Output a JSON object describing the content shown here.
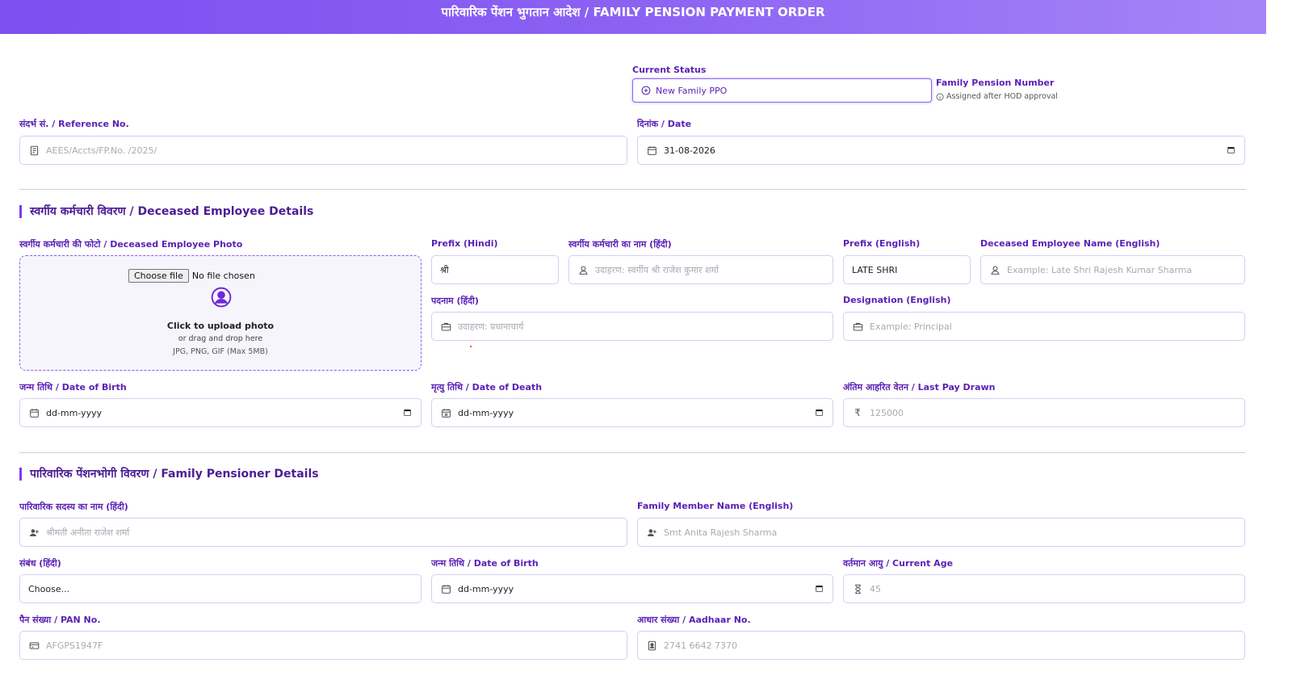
{
  "header": {
    "title": "पारिवारिक पेंशन भुगतान आदेश / FAMILY PENSION PAYMENT ORDER"
  },
  "status": {
    "label": "Current Status",
    "value": "New Family PPO",
    "fpn_label": "Family Pension Number",
    "fpn_hint": "Assigned after HOD approval"
  },
  "reference": {
    "label": "संदर्भ सं. / Reference No.",
    "placeholder": "AEES/Accts/FP.No. /2025/"
  },
  "date": {
    "label": "दिनांक / Date",
    "value": "31-08-2026"
  },
  "deceased": {
    "section_title": "स्वर्गीय कर्मचारी विवरण / Deceased Employee Details",
    "photo_label": "स्वर्गीय कर्मचारी की फोटो / Deceased Employee Photo",
    "choose_file": "Choose file",
    "no_file": "No file chosen",
    "upload_title": "Click to upload photo",
    "upload_sub": "or drag and drop here",
    "upload_types": "JPG, PNG, GIF (Max 5MB)",
    "prefix_hindi_label": "Prefix (Hindi)",
    "prefix_hindi_value": "श्री",
    "name_hindi_label": "स्वर्गीय कर्मचारी का नाम (हिंदी)",
    "name_hindi_placeholder": "उदाहरण: स्वर्गीय श्री राजेश कुमार शर्मा",
    "prefix_english_label": "Prefix (English)",
    "prefix_english_value": "LATE SHRI",
    "name_english_label": "Deceased Employee Name (English)",
    "name_english_placeholder": "Example: Late Shri Rajesh Kumar Sharma",
    "designation_hindi_label": "पदनाम (हिंदी)",
    "designation_hindi_placeholder": "उदाहरण: प्रधानाचार्य",
    "designation_english_label": "Designation (English)",
    "designation_english_placeholder": "Example: Principal",
    "dob_label": "जन्म तिथि / Date of Birth",
    "dob_value": "dd-mm-yyyy",
    "dod_label": "मृत्यु तिथि / Date of Death",
    "dod_value": "dd-mm-yyyy",
    "lastpay_label": "अंतिम आहरित वेतन / Last Pay Drawn",
    "lastpay_placeholder": "125000"
  },
  "family": {
    "section_title": "पारिवारिक पेंशनभोगी विवरण / Family Pensioner Details",
    "name_hindi_label": "पारिवारिक सदस्य का नाम (हिंदी)",
    "name_hindi_placeholder": "श्रीमती अनीता राजेश शर्मा",
    "name_english_label": "Family Member Name (English)",
    "name_english_placeholder": "Smt Anita Rajesh Sharma",
    "relation_label": "संबंध (हिंदी)",
    "relation_value": "Choose...",
    "dob_label": "जन्म तिथि / Date of Birth",
    "dob_value": "dd-mm-yyyy",
    "age_label": "वर्तमान आयु / Current Age",
    "age_placeholder": "45",
    "pan_label": "पैन संख्या / PAN No.",
    "pan_placeholder": "AFGPS1947F",
    "aadhaar_label": "आधार संख्या / Aadhaar No.",
    "aadhaar_placeholder": "2741 6642 7370"
  }
}
